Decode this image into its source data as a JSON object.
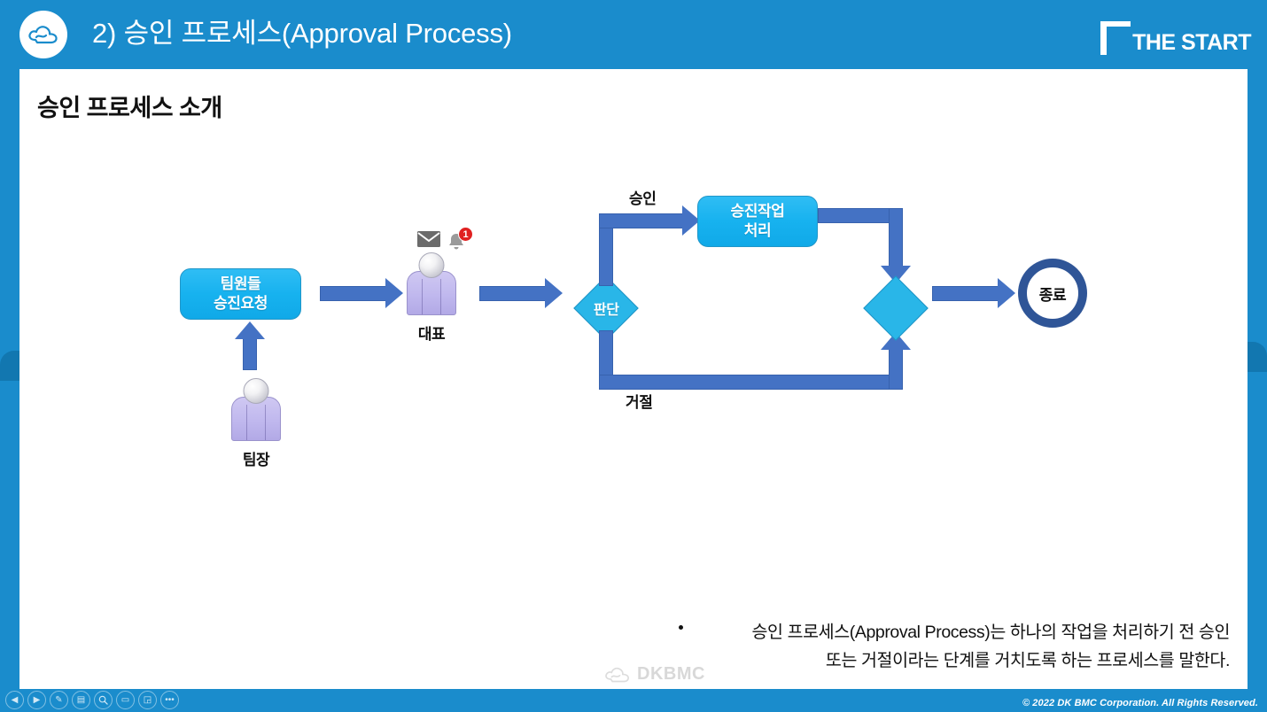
{
  "header": {
    "title": "2) 승인 프로세스(Approval Process)",
    "logo_icon": "dkbmc-cloud-logo",
    "brand_bracket_icon": "square-bracket-icon",
    "brand_text": "THE START",
    "bg_color": "#1a8ccc"
  },
  "content": {
    "section_title": "승인 프로세스 소개"
  },
  "flow": {
    "request_box": "팀원들\n승진요청",
    "request_box_line1": "팀원들",
    "request_box_line2": "승진요청",
    "process_box_line1": "승진작업",
    "process_box_line2": "처리",
    "decision_label": "판단",
    "merge_label": "",
    "end_label": "종료",
    "approve_label": "승인",
    "reject_label": "거절",
    "person_leader_label": "대표",
    "person_teamlead_label": "팀장",
    "notification_count": "1",
    "mail_icon": "envelope-icon",
    "bell_icon": "bell-icon",
    "box_color": "#17b2ef",
    "diamond_color": "#29b6e8",
    "arrow_color": "#4472c4",
    "end_ring_color": "#2f5597"
  },
  "bullets": [
    {
      "line1": "승인 프로세스(Approval Process)는 하나의 작업을 처리하기 전 승인",
      "line2": "또는 거절이라는 단계를 거치도록 하는 프로세스를 말한다."
    }
  ],
  "watermark": {
    "text": "DKBMC",
    "icon": "dkbmc-cloud-logo"
  },
  "footer": {
    "copyright": "© 2022 DK BMC Corporation. All Rights Reserved."
  },
  "toolbar": {
    "buttons": [
      {
        "name": "previous-slide-button",
        "glyph": "◀"
      },
      {
        "name": "next-slide-button",
        "glyph": "▶"
      },
      {
        "name": "pen-tool-button",
        "glyph": "✎"
      },
      {
        "name": "all-slides-button",
        "glyph": "▤"
      },
      {
        "name": "zoom-button",
        "glyph": "🔍"
      },
      {
        "name": "subtitles-button",
        "glyph": "▭"
      },
      {
        "name": "presenter-view-button",
        "glyph": "◲"
      },
      {
        "name": "more-options-button",
        "glyph": "•••"
      }
    ]
  }
}
